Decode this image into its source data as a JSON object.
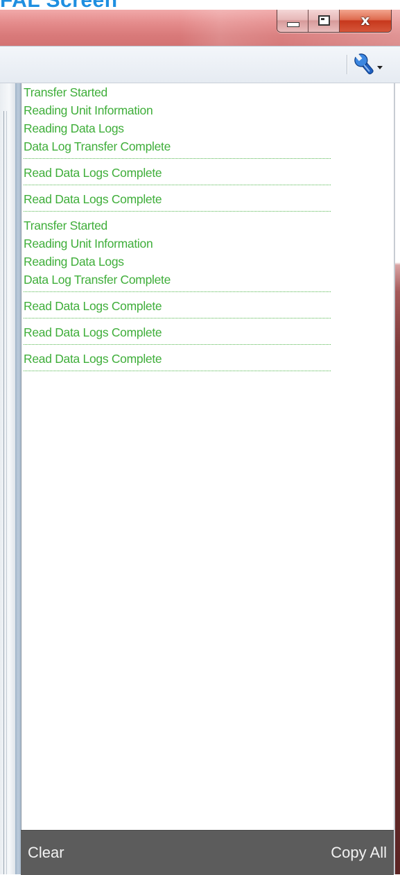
{
  "page": {
    "heading_fragment": "FAL Screen"
  },
  "window": {
    "caption": {
      "minimize_icon": "minimize-icon",
      "maximize_icon": "maximize-icon",
      "close_label": "x"
    },
    "colors": {
      "titlebar": "#d97a7a",
      "log_text": "#3fae3a",
      "bottom_bar": "#5c5c5c"
    }
  },
  "toolbar": {
    "tools_icon": "wrench-icon",
    "dropdown_icon": "chevron-down-icon"
  },
  "log": {
    "groups": [
      {
        "lines": [
          "Transfer Started",
          "Reading Unit Information",
          "Reading Data Logs",
          "Data Log Transfer Complete"
        ]
      },
      {
        "lines": [
          "Read Data Logs Complete"
        ]
      },
      {
        "lines": [
          "Read Data Logs Complete"
        ]
      },
      {
        "lines": [
          "Transfer Started",
          "Reading Unit Information",
          "Reading Data Logs",
          "Data Log Transfer Complete"
        ]
      },
      {
        "lines": [
          "Read Data Logs Complete"
        ]
      },
      {
        "lines": [
          "Read Data Logs Complete"
        ]
      },
      {
        "lines": [
          "Read Data Logs Complete"
        ]
      }
    ]
  },
  "footer": {
    "clear_label": "Clear",
    "copy_all_label": "Copy All"
  }
}
